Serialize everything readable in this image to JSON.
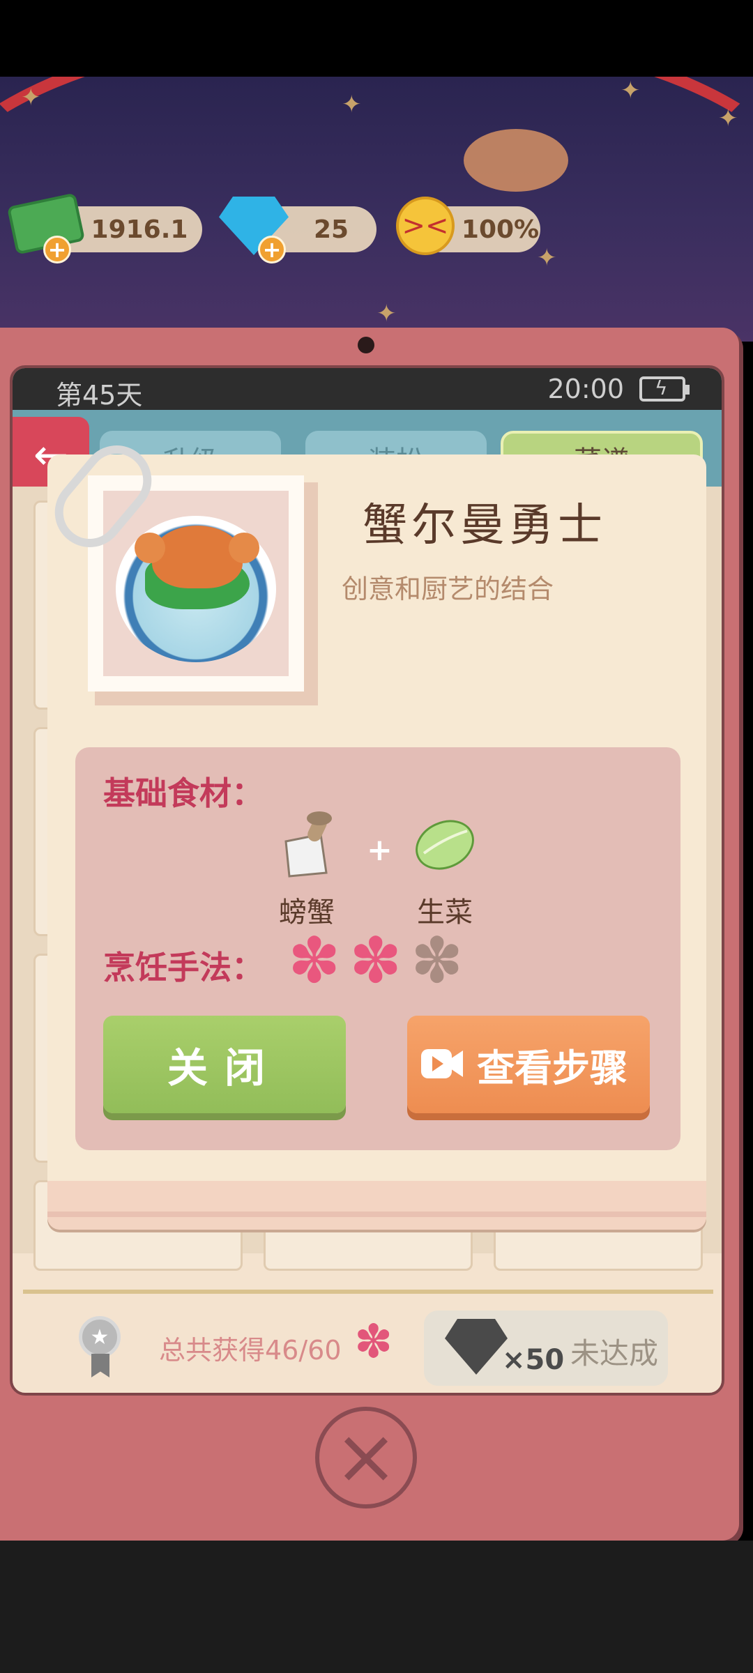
{
  "resources": {
    "money": "1916.1",
    "gems": "25",
    "satisfaction": "100%"
  },
  "phone": {
    "day": "第45天",
    "time": "20:00",
    "tabs": [
      "升级",
      "装扮",
      "菜谱"
    ]
  },
  "recipe": {
    "name": "蟹尔曼勇士",
    "subtitle": "创意和厨艺的结合",
    "ingredients_label": "基础食材：",
    "ingredients": [
      "螃蟹",
      "生菜"
    ],
    "cooking_label": "烹饪手法：",
    "rating": 2,
    "rating_max": 3,
    "close_button": "关闭",
    "steps_button": "查看步骤"
  },
  "footer": {
    "total_text": "总共获得46/60",
    "reward_amount": "×50",
    "status": "未达成"
  },
  "colors": {
    "accent_green": "#a9cf6b",
    "accent_orange": "#f6a36a",
    "flower_pink": "#e9577e",
    "label_red": "#c33a5a"
  }
}
